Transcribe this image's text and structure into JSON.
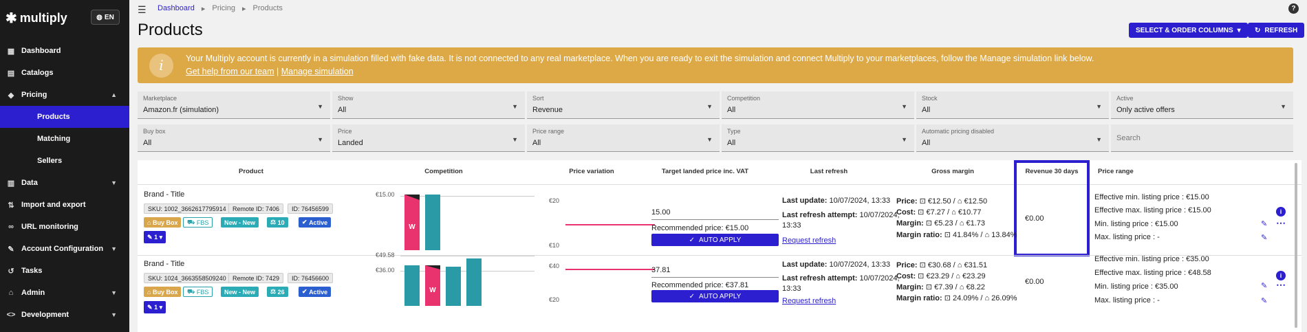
{
  "app": {
    "logo": "multiply",
    "lang": "EN"
  },
  "nav": [
    {
      "label": "Dashboard"
    },
    {
      "label": "Catalogs"
    },
    {
      "label": "Pricing"
    },
    {
      "label": "Products"
    },
    {
      "label": "Matching"
    },
    {
      "label": "Sellers"
    },
    {
      "label": "Data"
    },
    {
      "label": "Import and export"
    },
    {
      "label": "URL monitoring"
    },
    {
      "label": "Account Configuration"
    },
    {
      "label": "Tasks"
    },
    {
      "label": "Admin"
    },
    {
      "label": "Development"
    }
  ],
  "breadcrumb": [
    "Dashboard",
    "Pricing",
    "Products"
  ],
  "page_title": "Products",
  "toolbar": {
    "columns_label": "SELECT & ORDER COLUMNS",
    "refresh_label": "REFRESH"
  },
  "banner": {
    "message": "Your Multiply account is currently in a simulation filled with fake data. It is not connected to any real marketplace. When you are ready to exit the simulation and connect Multiply to your marketplaces, follow the Manage simulation link below.",
    "help_link": "Get help from our team",
    "separator": "|",
    "manage_link": "Manage simulation"
  },
  "filters": [
    {
      "label": "Marketplace",
      "value": "Amazon.fr (simulation)"
    },
    {
      "label": "Show",
      "value": "All"
    },
    {
      "label": "Sort",
      "value": "Revenue"
    },
    {
      "label": "Competition",
      "value": "All"
    },
    {
      "label": "Stock",
      "value": "All"
    },
    {
      "label": "Active",
      "value": "Only active offers"
    },
    {
      "label": "Buy box",
      "value": "All"
    },
    {
      "label": "Price",
      "value": "Landed"
    },
    {
      "label": "Price range",
      "value": "All"
    },
    {
      "label": "Type",
      "value": "All"
    },
    {
      "label": "Automatic pricing disabled",
      "value": "All"
    }
  ],
  "search": {
    "placeholder": "Search"
  },
  "columns": [
    "Product",
    "Competition",
    "Price variation",
    "Target landed price inc. VAT",
    "Last refresh",
    "Gross margin",
    "Revenue 30 days",
    "Price range"
  ],
  "rows": [
    {
      "title": "Brand - Title",
      "sku": "SKU: 1002_3662617795914",
      "remote": "Remote ID: 7406",
      "id": "ID: 76456599",
      "tags": [
        "Buy Box",
        "FBS",
        "New - New",
        "10",
        "Active"
      ],
      "variant": "1",
      "comp_axis": "€15.00",
      "pv_top": "€20",
      "pv_bottom": "€10",
      "target": "15.00",
      "recommended": "Recommended price: €15.00",
      "auto_apply": "AUTO APPLY",
      "last_update_label": "Last update:",
      "last_update": "10/07/2024, 13:33",
      "last_attempt_label": "Last refresh attempt:",
      "last_attempt": "10/07/2024,",
      "last_attempt_time": "13:33",
      "request_refresh": "Request refresh",
      "price": "€12.50 / ",
      "price2": "€12.50",
      "cost": "€7.27 / ",
      "cost2": "€10.77",
      "margin": "€5.23 / ",
      "margin2": "€1.73",
      "ratio": "41.84% / ",
      "ratio2": "13.84%",
      "revenue": "€0.00",
      "eff_min": "Effective min. listing price :  €15.00",
      "eff_max": "Effective max. listing price :  €15.00",
      "min_lp": "Min. listing price :  €15.00",
      "max_lp": "Max. listing price :  -"
    },
    {
      "title": "Brand - Title",
      "sku": "SKU: 1024_3663558509240",
      "remote": "Remote ID: 7429",
      "id": "ID: 76456600",
      "tags": [
        "Buy Box",
        "FBS",
        "New - New",
        "26",
        "Active"
      ],
      "variant": "1",
      "comp_axis_top": "€49.58",
      "comp_axis": "€36.00",
      "pv_top": "€40",
      "pv_bottom": "€20",
      "target": "37.81",
      "recommended": "Recommended price: €37.81",
      "auto_apply": "AUTO APPLY",
      "last_update_label": "Last update:",
      "last_update": "10/07/2024, 13:33",
      "last_attempt_label": "Last refresh attempt:",
      "last_attempt": "10/07/2024,",
      "last_attempt_time": "13:33",
      "request_refresh": "Request refresh",
      "price": "€30.68 / ",
      "price2": "€31.51",
      "cost": "€23.29 / ",
      "cost2": "€23.29",
      "margin": "€7.39 / ",
      "margin2": "€8.22",
      "ratio": "24.09% / ",
      "ratio2": "26.09%",
      "revenue": "€0.00",
      "eff_min": "Effective min. listing price :  €35.00",
      "eff_max": "Effective max. listing price :  €48.58",
      "min_lp": "Min. listing price :  €35.00",
      "max_lp": "Max. listing price :  -"
    }
  ],
  "labels": {
    "price": "Price:",
    "cost": "Cost:",
    "margin": "Margin:",
    "ratio": "Margin ratio:"
  },
  "colors": {
    "accent": "#2b1fcf",
    "banner": "#dda947",
    "teal": "#2aabb6",
    "pink": "#e8336f"
  }
}
